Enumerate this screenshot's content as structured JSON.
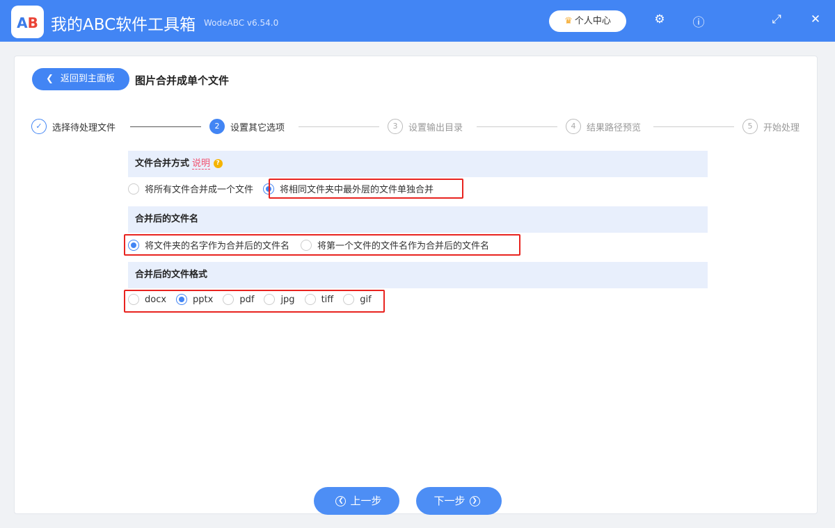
{
  "app": {
    "title": "我的ABC软件工具箱",
    "version": "WodeABC v6.54.0",
    "logo_text": "AB",
    "user_center": "个人中心"
  },
  "header": {
    "back": "返回到主面板",
    "page_title": "图片合并成单个文件"
  },
  "steps": [
    {
      "num": "✓",
      "label": "选择待处理文件"
    },
    {
      "num": "2",
      "label": "设置其它选项"
    },
    {
      "num": "3",
      "label": "设置输出目录"
    },
    {
      "num": "4",
      "label": "结果路径预览"
    },
    {
      "num": "5",
      "label": "开始处理"
    }
  ],
  "sections": {
    "merge_mode": {
      "title": "文件合并方式",
      "hint": "说明",
      "hint_icon": "?",
      "options": [
        "将所有文件合并成一个文件",
        "将相同文件夹中最外层的文件单独合并"
      ],
      "selected": 1
    },
    "file_name": {
      "title": "合并后的文件名",
      "options": [
        "将文件夹的名字作为合并后的文件名",
        "将第一个文件的文件名作为合并后的文件名"
      ],
      "selected": 0
    },
    "format": {
      "title": "合并后的文件格式",
      "options": [
        "docx",
        "pptx",
        "pdf",
        "jpg",
        "tiff",
        "gif"
      ],
      "selected": 1
    }
  },
  "footer": {
    "prev": "上一步",
    "next": "下一步"
  }
}
